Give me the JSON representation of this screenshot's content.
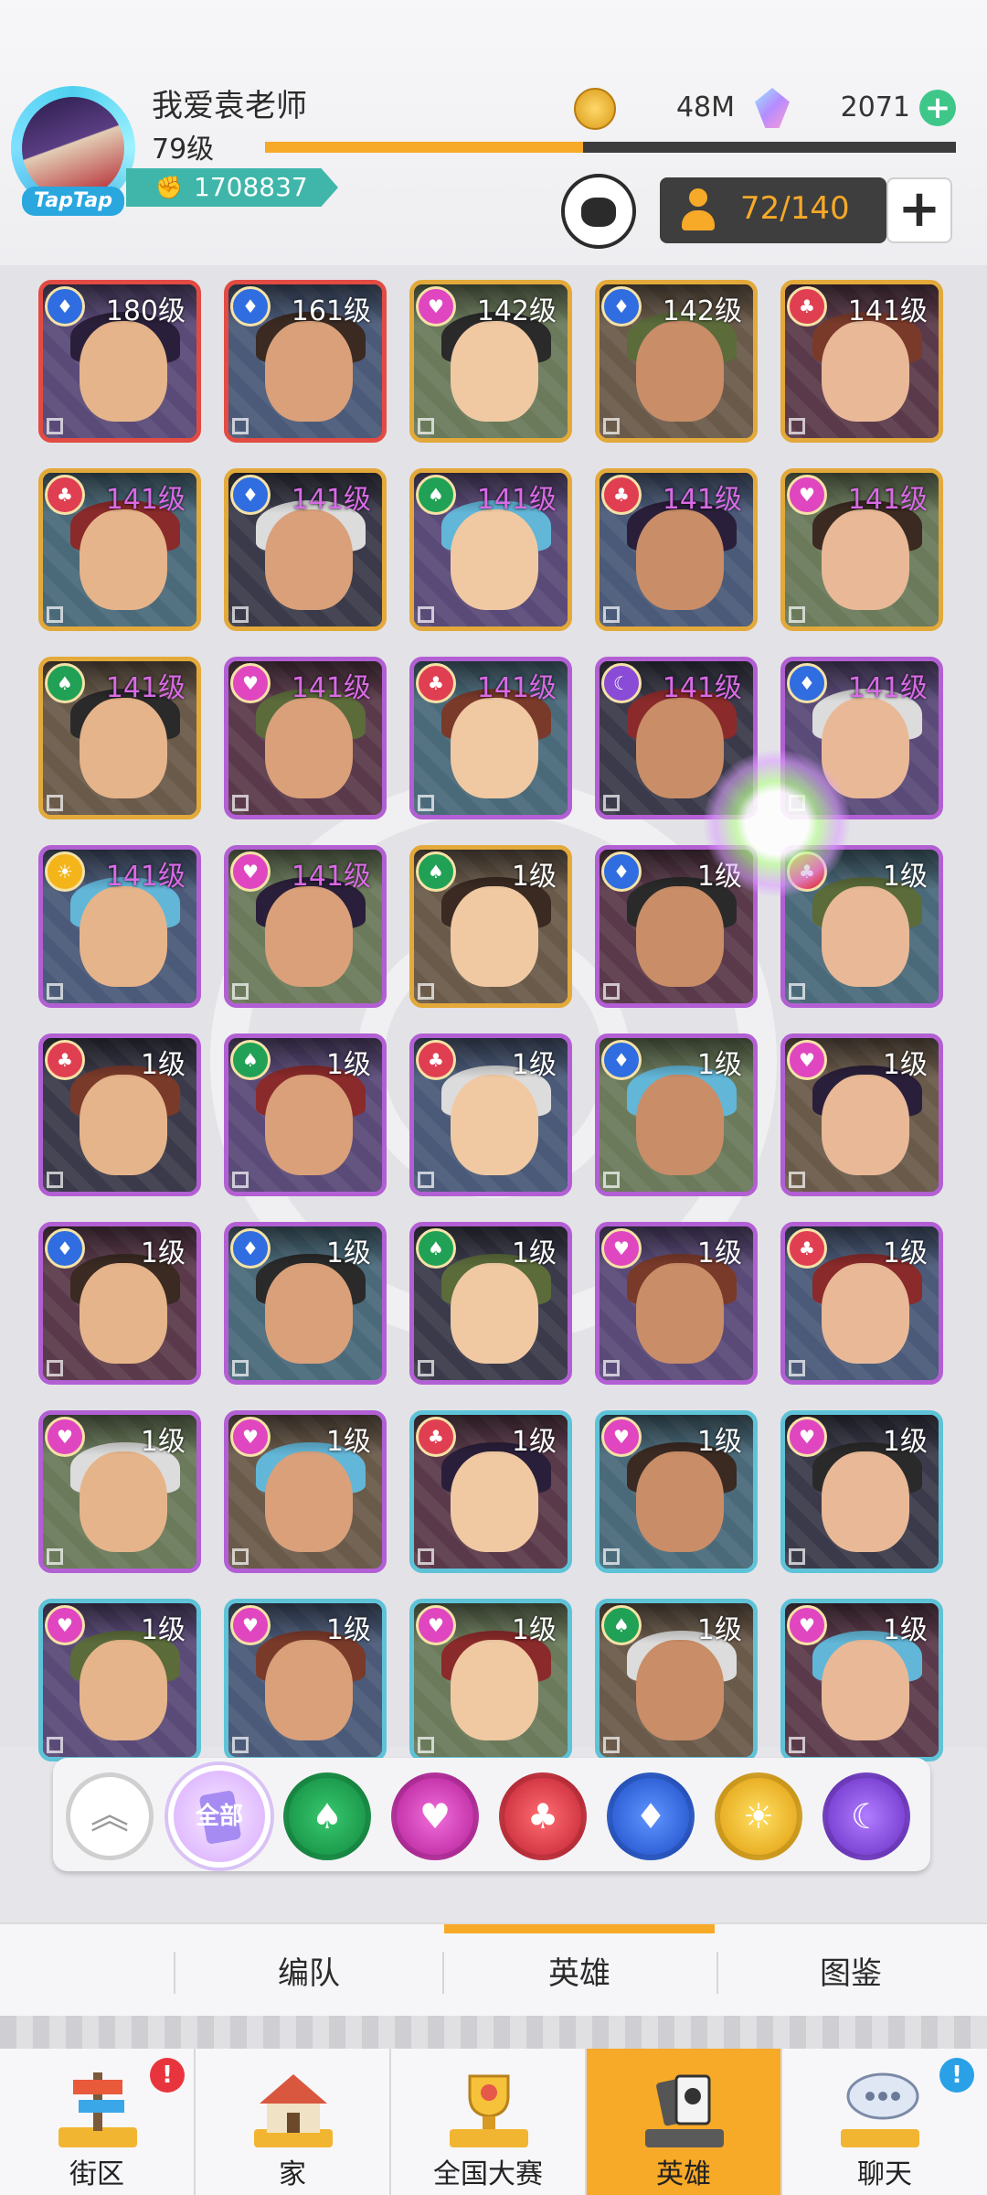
{
  "header": {
    "player_name": "我爱袁老师",
    "player_level": "79级",
    "xp_fraction": 0.46,
    "power": "1708837",
    "avatar_tag": "TapTap",
    "gold": "48M",
    "gems": "2071",
    "hero_capacity": "72/140"
  },
  "heroes": [
    {
      "level": "180级",
      "faction": "blue",
      "rarity": "red",
      "level_color": "white"
    },
    {
      "level": "161级",
      "faction": "blue",
      "rarity": "red",
      "level_color": "white"
    },
    {
      "level": "142级",
      "faction": "pink",
      "rarity": "gold",
      "level_color": "white"
    },
    {
      "level": "142级",
      "faction": "blue",
      "rarity": "gold",
      "level_color": "white"
    },
    {
      "level": "141级",
      "faction": "red",
      "rarity": "gold",
      "level_color": "white"
    },
    {
      "level": "141级",
      "faction": "red",
      "rarity": "gold",
      "level_color": "purple"
    },
    {
      "level": "141级",
      "faction": "blue",
      "rarity": "gold",
      "level_color": "purple"
    },
    {
      "level": "141级",
      "faction": "green",
      "rarity": "gold",
      "level_color": "purple"
    },
    {
      "level": "141级",
      "faction": "red",
      "rarity": "gold",
      "level_color": "purple"
    },
    {
      "level": "141级",
      "faction": "pink",
      "rarity": "gold",
      "level_color": "purple"
    },
    {
      "level": "141级",
      "faction": "green",
      "rarity": "gold",
      "level_color": "purple"
    },
    {
      "level": "141级",
      "faction": "pink",
      "rarity": "purple",
      "level_color": "purple"
    },
    {
      "level": "141级",
      "faction": "red",
      "rarity": "purple",
      "level_color": "purple"
    },
    {
      "level": "141级",
      "faction": "moon",
      "rarity": "purple",
      "level_color": "purple"
    },
    {
      "level": "141级",
      "faction": "blue",
      "rarity": "purple",
      "level_color": "purple"
    },
    {
      "level": "141级",
      "faction": "sun",
      "rarity": "purple",
      "level_color": "purple"
    },
    {
      "level": "141级",
      "faction": "pink",
      "rarity": "purple",
      "level_color": "purple"
    },
    {
      "level": "1级",
      "faction": "green",
      "rarity": "gold",
      "level_color": "white"
    },
    {
      "level": "1级",
      "faction": "blue",
      "rarity": "purple",
      "level_color": "white"
    },
    {
      "level": "1级",
      "faction": "red",
      "rarity": "purple",
      "level_color": "white"
    },
    {
      "level": "1级",
      "faction": "red",
      "rarity": "purple",
      "level_color": "white"
    },
    {
      "level": "1级",
      "faction": "green",
      "rarity": "purple",
      "level_color": "white"
    },
    {
      "level": "1级",
      "faction": "red",
      "rarity": "purple",
      "level_color": "white"
    },
    {
      "level": "1级",
      "faction": "blue",
      "rarity": "purple",
      "level_color": "white"
    },
    {
      "level": "1级",
      "faction": "pink",
      "rarity": "purple",
      "level_color": "white"
    },
    {
      "level": "1级",
      "faction": "blue",
      "rarity": "purple",
      "level_color": "white"
    },
    {
      "level": "1级",
      "faction": "blue",
      "rarity": "purple",
      "level_color": "white"
    },
    {
      "level": "1级",
      "faction": "green",
      "rarity": "purple",
      "level_color": "white"
    },
    {
      "level": "1级",
      "faction": "pink",
      "rarity": "purple",
      "level_color": "white"
    },
    {
      "level": "1级",
      "faction": "red",
      "rarity": "purple",
      "level_color": "white"
    },
    {
      "level": "1级",
      "faction": "pink",
      "rarity": "purple",
      "level_color": "white"
    },
    {
      "level": "1级",
      "faction": "pink",
      "rarity": "purple",
      "level_color": "white"
    },
    {
      "level": "1级",
      "faction": "red",
      "rarity": "teal",
      "level_color": "white"
    },
    {
      "level": "1级",
      "faction": "pink",
      "rarity": "teal",
      "level_color": "white"
    },
    {
      "level": "1级",
      "faction": "pink",
      "rarity": "teal",
      "level_color": "white"
    },
    {
      "level": "1级",
      "faction": "pink",
      "rarity": "teal",
      "level_color": "white"
    },
    {
      "level": "1级",
      "faction": "pink",
      "rarity": "teal",
      "level_color": "white"
    },
    {
      "level": "1级",
      "faction": "pink",
      "rarity": "teal",
      "level_color": "white"
    },
    {
      "level": "1级",
      "faction": "green",
      "rarity": "teal",
      "level_color": "white"
    },
    {
      "level": "1级",
      "faction": "pink",
      "rarity": "teal",
      "level_color": "white"
    }
  ],
  "filters": {
    "all_label": "全部",
    "items": [
      "collapse",
      "all",
      "green",
      "pink",
      "red",
      "blue",
      "sun",
      "moon"
    ]
  },
  "sub_tabs": [
    "编队",
    "英雄",
    "图鉴"
  ],
  "sub_tab_active": "英雄",
  "bottom_nav": {
    "items": [
      {
        "label": "街区",
        "badge": "!"
      },
      {
        "label": "家",
        "badge": ""
      },
      {
        "label": "全国大赛",
        "badge": ""
      },
      {
        "label": "英雄",
        "badge": ""
      },
      {
        "label": "聊天",
        "badge": "!"
      }
    ],
    "active": "英雄"
  },
  "colors": {
    "accent": "#f7a928",
    "power_badge": "#3fb6a9",
    "rarity_gold": "#e3a93a",
    "rarity_red": "#e24b43",
    "rarity_purple": "#b35fd4",
    "rarity_teal": "#5fc3d8"
  }
}
